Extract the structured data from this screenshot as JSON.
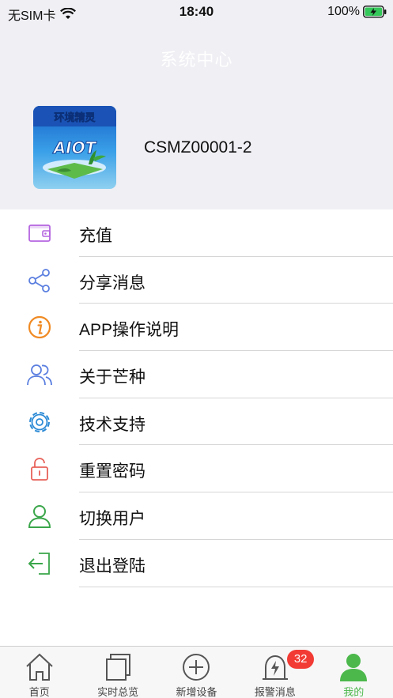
{
  "status_bar": {
    "carrier": "无SIM卡",
    "time": "18:40",
    "battery": "100%"
  },
  "header": {
    "title": "系统中心",
    "avatar_text": "环境精灵",
    "avatar_logo": "AIOT",
    "account": "CSMZ00001-2"
  },
  "menu": {
    "items": [
      {
        "label": "充值",
        "icon": "wallet-icon",
        "color": "#b565e0"
      },
      {
        "label": "分享消息",
        "icon": "share-icon",
        "color": "#5b7fe0"
      },
      {
        "label": "APP操作说明",
        "icon": "info-icon",
        "color": "#f08a24"
      },
      {
        "label": "关于芒种",
        "icon": "users-icon",
        "color": "#5b7fe0"
      },
      {
        "label": "技术支持",
        "icon": "gear-icon",
        "color": "#2d8bd6"
      },
      {
        "label": "重置密码",
        "icon": "lock-icon",
        "color": "#e8625a"
      },
      {
        "label": "切换用户",
        "icon": "user-icon",
        "color": "#3aa64a"
      },
      {
        "label": "退出登陆",
        "icon": "logout-icon",
        "color": "#3aa64a"
      }
    ]
  },
  "tabbar": {
    "tabs": [
      {
        "label": "首页",
        "icon": "home-icon"
      },
      {
        "label": "实时总览",
        "icon": "overview-icon"
      },
      {
        "label": "新增设备",
        "icon": "add-device-icon"
      },
      {
        "label": "报警消息",
        "icon": "alarm-icon",
        "badge": "32"
      },
      {
        "label": "我的",
        "icon": "profile-icon",
        "active": true
      }
    ],
    "active_color": "#4cb84c"
  }
}
